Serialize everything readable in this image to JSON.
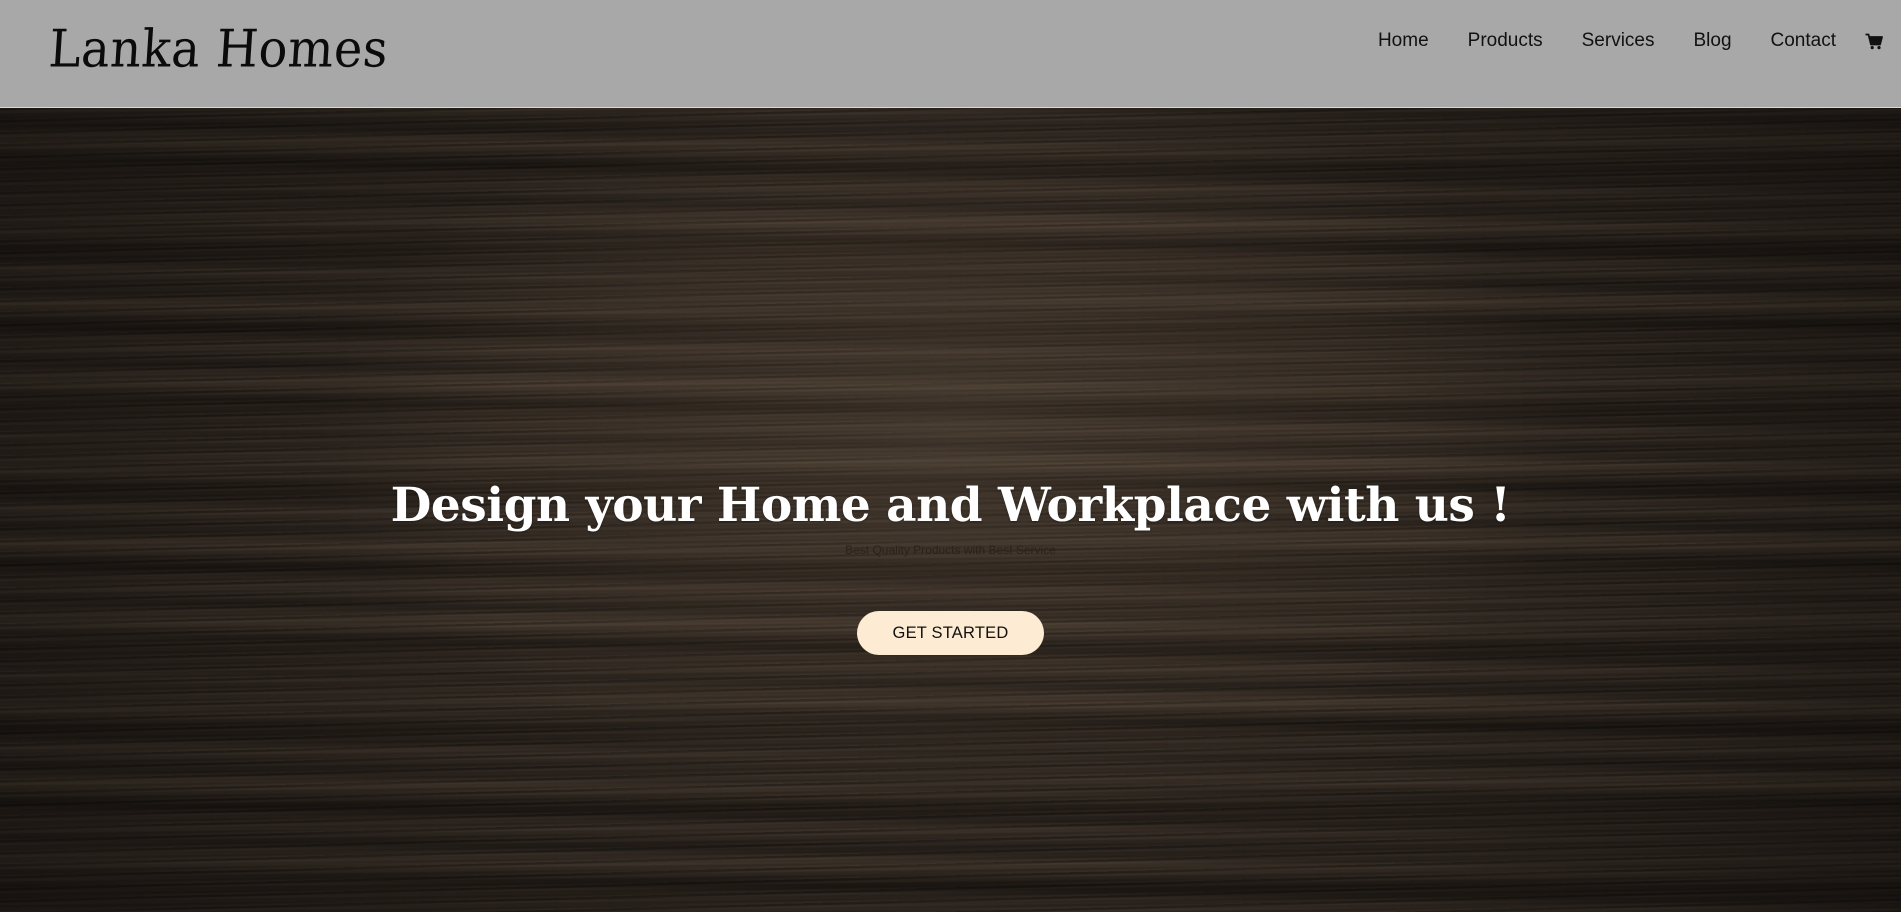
{
  "brand": {
    "logo_text": "Lanka Homes"
  },
  "nav": {
    "items": [
      {
        "label": "Home"
      },
      {
        "label": "Products"
      },
      {
        "label": "Services"
      },
      {
        "label": "Blog"
      },
      {
        "label": "Contact"
      }
    ],
    "cart_icon": "shopping-cart-icon"
  },
  "hero": {
    "title": "Design your Home and Workplace with us !",
    "subtitle": "Best Quality Products with Best Service",
    "cta_label": "GET STARTED"
  },
  "colors": {
    "header_bg": "#a8a8a8",
    "cta_bg": "#fdebd3",
    "hero_text": "#ffffff"
  }
}
